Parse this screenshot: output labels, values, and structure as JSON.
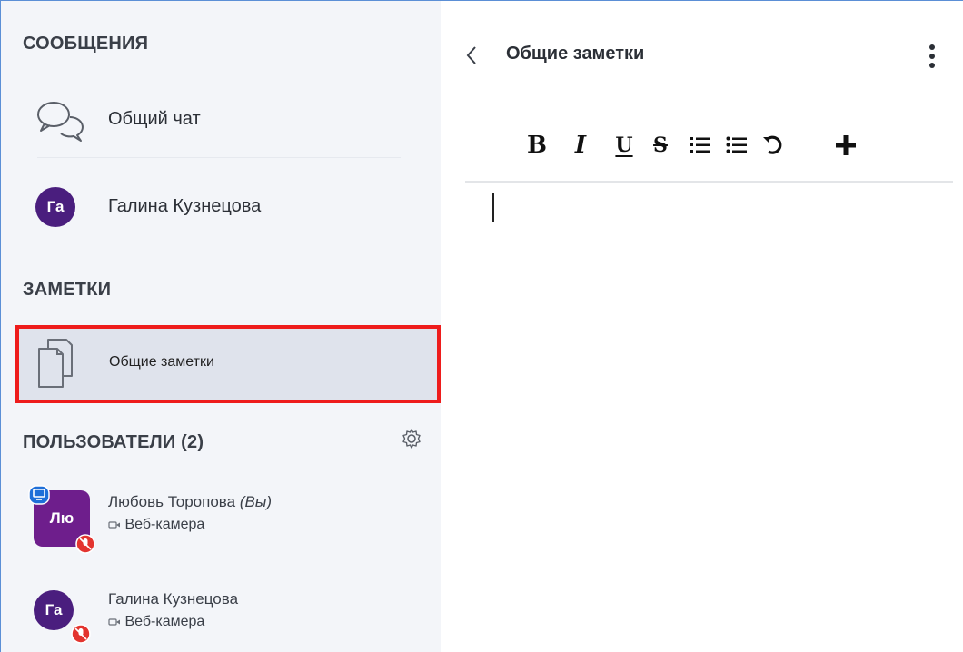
{
  "sidebar": {
    "messages_title": "СООБЩЕНИЯ",
    "public_chat_label": "Общий чат",
    "private_chat": {
      "initials": "Га",
      "name": "Галина Кузнецова"
    },
    "notes_title": "ЗАМЕТКИ",
    "shared_notes_label": "Общие заметки",
    "users_title": "ПОЛЬЗОВАТЕЛИ (2)",
    "users": [
      {
        "initials": "Лю",
        "name": "Любовь Торопова",
        "you_tag": "(Вы)",
        "status": "Веб-камера"
      },
      {
        "initials": "Га",
        "name": "Галина Кузнецова",
        "you_tag": "",
        "status": "Веб-камера"
      }
    ]
  },
  "main": {
    "title": "Общие заметки",
    "toolbar": {
      "bold": "B",
      "italic": "I",
      "underline": "U",
      "strike": "S"
    }
  },
  "colors": {
    "accent_avatar": "#4a1e7e",
    "highlight_border": "#ee1c1c",
    "sidebar_bg": "#f3f5f9",
    "mute_badge": "#e3342f",
    "presenter_badge": "#1e6fd8"
  },
  "icons": [
    "chat-bubbles-icon",
    "notes-pages-icon",
    "gear-icon",
    "back-chevron-icon",
    "kebab-menu-icon",
    "ordered-list-icon",
    "bullet-list-icon",
    "undo-icon",
    "plus-icon",
    "camera-icon",
    "mic-muted-icon",
    "presenter-icon"
  ]
}
